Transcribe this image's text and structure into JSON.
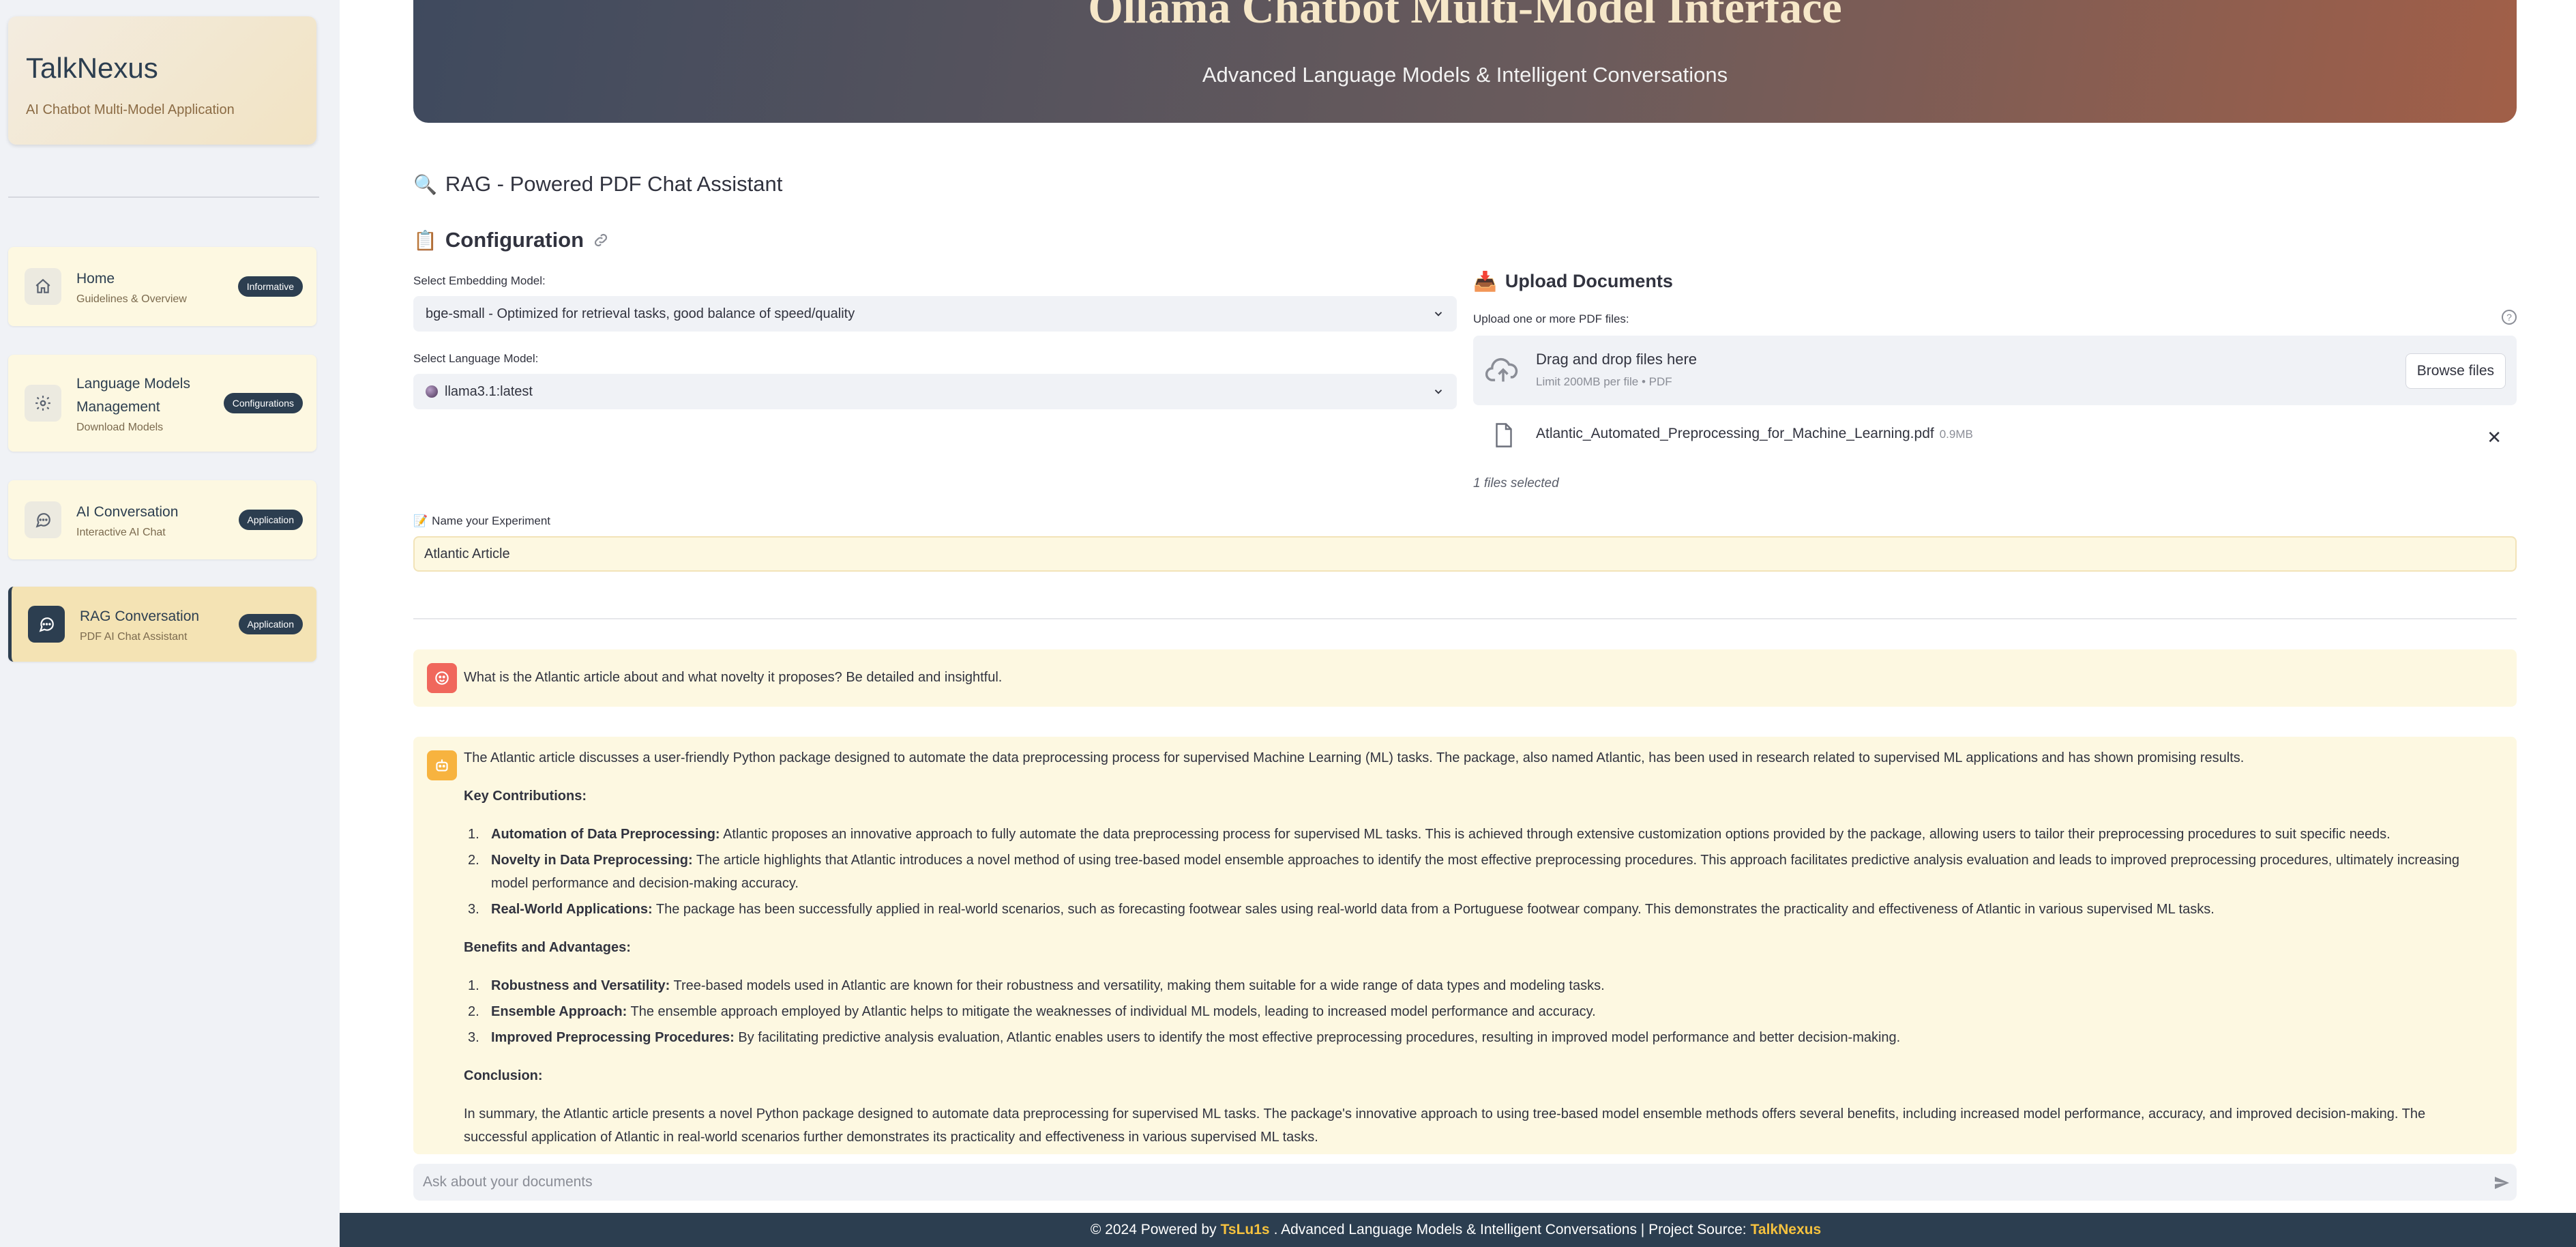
{
  "sidebar": {
    "brand_name": "TalkNexus",
    "brand_sub": "AI Chatbot Multi-Model Application",
    "items": [
      {
        "title": "Home",
        "sub": "Guidelines & Overview",
        "badge": "Informative",
        "icon": "home-icon"
      },
      {
        "title": "Language Models Management",
        "sub": "Download Models",
        "badge": "Configurations",
        "icon": "gear-icon"
      },
      {
        "title": "AI Conversation",
        "sub": "Interactive AI Chat",
        "badge": "Application",
        "icon": "chat-icon"
      },
      {
        "title": "RAG Conversation",
        "sub": "PDF AI Chat Assistant",
        "badge": "Application",
        "icon": "chat-icon",
        "active": true
      }
    ]
  },
  "hero": {
    "title": "Ollama Chatbot Multi-Model Interface",
    "subtitle": "Advanced Language Models & Intelligent Conversations"
  },
  "page_title": "RAG - Powered PDF Chat Assistant",
  "config": {
    "title": "Configuration",
    "embedding_label": "Select Embedding Model:",
    "embedding_value": "bge-small - Optimized for retrieval tasks, good balance of speed/quality",
    "language_label": "Select Language Model:",
    "language_value": "llama3.1:latest"
  },
  "upload": {
    "title": "Upload Documents",
    "label": "Upload one or more PDF files:",
    "drop_text": "Drag and drop files here",
    "limit_text": "Limit 200MB per file • PDF",
    "browse_label": "Browse files",
    "file_name": "Atlantic_Automated_Preprocessing_for_Machine_Learning.pdf",
    "file_size": "0.9MB",
    "files_selected": "1 files selected"
  },
  "experiment": {
    "label": "Name your Experiment",
    "value": "Atlantic Article"
  },
  "chat": {
    "user_message": "What is the Atlantic article about and what novelty it proposes? Be detailed and insightful.",
    "assistant": {
      "intro": "The Atlantic article discusses a user-friendly Python package designed to automate the data preprocessing process for supervised Machine Learning (ML) tasks. The package, also named Atlantic, has been used in research related to supervised ML applications and has shown promising results.",
      "contributions_heading": "Key Contributions:",
      "contributions": [
        {
          "num": "1.",
          "term": "Automation of Data Preprocessing:",
          "text": "Atlantic proposes an innovative approach to fully automate the data preprocessing process for supervised ML tasks. This is achieved through extensive customization options provided by the package, allowing users to tailor their preprocessing procedures to suit specific needs."
        },
        {
          "num": "2.",
          "term": "Novelty in Data Preprocessing:",
          "text": "The article highlights that Atlantic introduces a novel method of using tree-based model ensemble approaches to identify the most effective preprocessing procedures. This approach facilitates predictive analysis evaluation and leads to improved preprocessing procedures, ultimately increasing model performance and decision-making accuracy."
        },
        {
          "num": "3.",
          "term": "Real-World Applications:",
          "text": "The package has been successfully applied in real-world scenarios, such as forecasting footwear sales using real-world data from a Portuguese footwear company. This demonstrates the practicality and effectiveness of Atlantic in various supervised ML tasks."
        }
      ],
      "benefits_heading": "Benefits and Advantages:",
      "benefits": [
        {
          "num": "1.",
          "term": "Robustness and Versatility:",
          "text": "Tree-based models used in Atlantic are known for their robustness and versatility, making them suitable for a wide range of data types and modeling tasks."
        },
        {
          "num": "2.",
          "term": "Ensemble Approach:",
          "text": "The ensemble approach employed by Atlantic helps to mitigate the weaknesses of individual ML models, leading to increased model performance and accuracy."
        },
        {
          "num": "3.",
          "term": "Improved Preprocessing Procedures:",
          "text": "By facilitating predictive analysis evaluation, Atlantic enables users to identify the most effective preprocessing procedures, resulting in improved model performance and better decision-making."
        }
      ],
      "conclusion_heading": "Conclusion:",
      "conclusion": "In summary, the Atlantic article presents a novel Python package designed to automate data preprocessing for supervised ML tasks. The package's innovative approach to using tree-based model ensemble methods offers several benefits, including increased model performance, accuracy, and improved decision-making. The successful application of Atlantic in real-world scenarios further demonstrates its practicality and effectiveness in various supervised ML tasks."
    },
    "input_placeholder": "Ask about your documents"
  },
  "footer": {
    "prefix": "© 2024 Powered by",
    "author": "TsLu1s",
    "middle": ". Advanced Language Models & Intelligent Conversations | Project Source:",
    "project": "TalkNexus"
  },
  "colors": {
    "sidebar_bg": "#f0f2f6",
    "accent_dark": "#2c3e50",
    "card_bg": "#fdf8e1",
    "footer_highlight": "#f6c23e"
  }
}
